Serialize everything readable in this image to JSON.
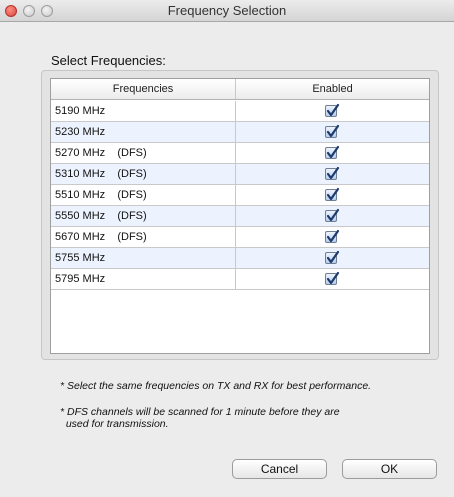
{
  "window": {
    "title": "Frequency Selection"
  },
  "section_label": "Select Frequencies:",
  "table": {
    "columns": [
      "Frequencies",
      "Enabled"
    ],
    "rows": [
      {
        "frequency": "5190 MHz",
        "enabled": true
      },
      {
        "frequency": "5230 MHz",
        "enabled": true
      },
      {
        "frequency": "5270 MHz    (DFS)",
        "enabled": true
      },
      {
        "frequency": "5310 MHz    (DFS)",
        "enabled": true
      },
      {
        "frequency": "5510 MHz    (DFS)",
        "enabled": true
      },
      {
        "frequency": "5550 MHz    (DFS)",
        "enabled": true
      },
      {
        "frequency": "5670 MHz    (DFS)",
        "enabled": true
      },
      {
        "frequency": "5755 MHz",
        "enabled": true
      },
      {
        "frequency": "5795 MHz",
        "enabled": true
      }
    ]
  },
  "notes": {
    "note1": "* Select the same frequencies on TX and RX for best performance.",
    "note2": "* DFS channels will be scanned for 1 minute before they are\n  used for transmission."
  },
  "buttons": {
    "cancel": "Cancel",
    "ok": "OK"
  },
  "colors": {
    "row_alt": "#edf3fe",
    "checkmark": "#1d3b6d"
  }
}
